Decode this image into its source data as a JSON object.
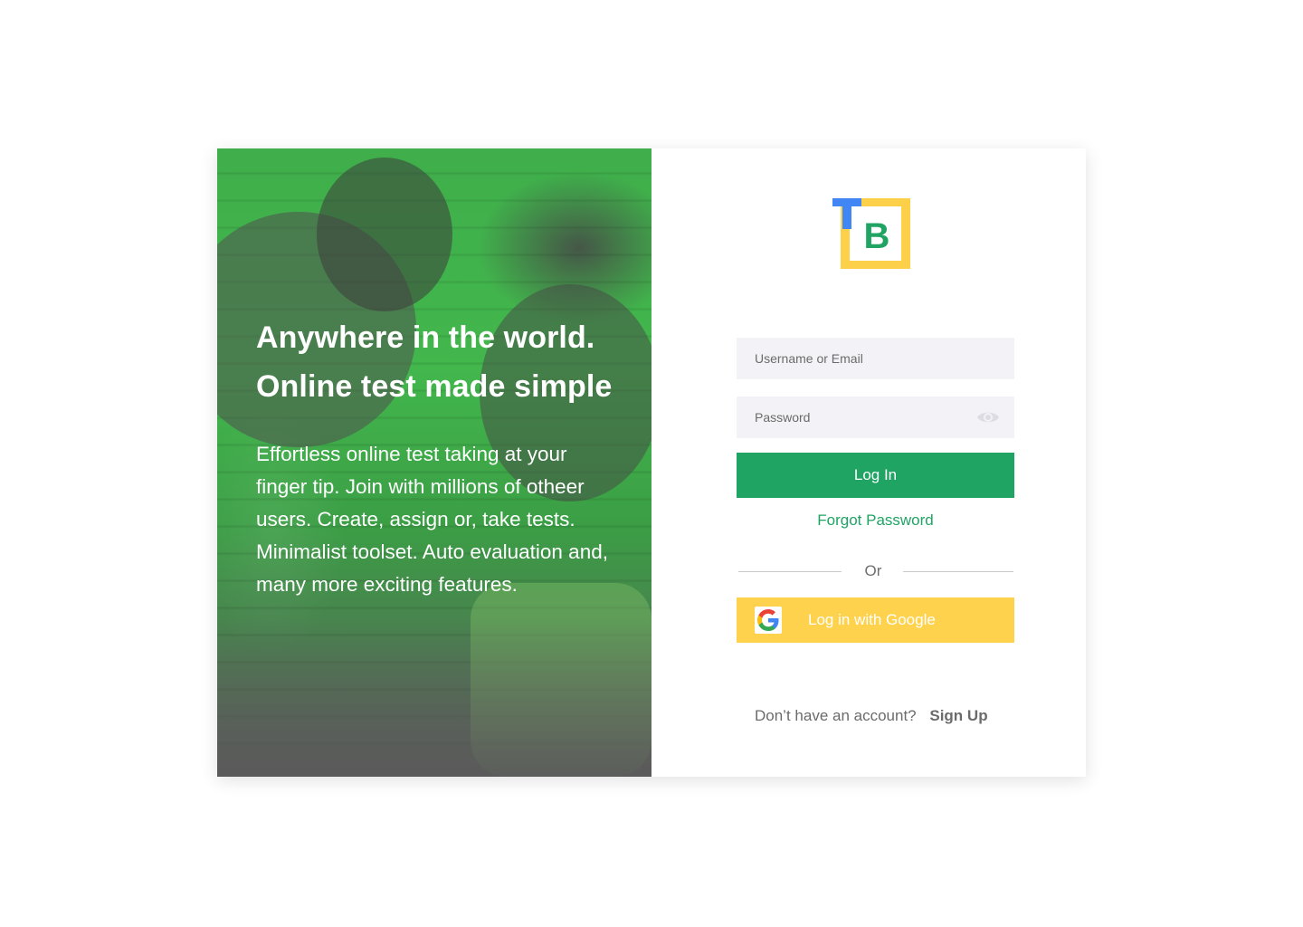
{
  "hero": {
    "title_line1": "Anywhere in the world.",
    "title_line2": "Online test made simple",
    "description": "Effortless online test taking at your finger tip. Join with millions of otheer users. Create, assign or, take tests. Minimalist toolset. Auto evaluation and, many more exciting features."
  },
  "logo": {
    "letter_t": "T",
    "letter_b": "B",
    "colors": {
      "t": "#4285f4",
      "b": "#20a464",
      "frame": "#fdd04a"
    }
  },
  "form": {
    "username_placeholder": "Username or Email",
    "password_placeholder": "Password",
    "password_toggle_icon": "eye-icon",
    "login_label": "Log In",
    "forgot_label": "Forgot Password",
    "or_label": "Or",
    "google_label": "Log in with Google",
    "google_icon": "google-g-icon"
  },
  "signup": {
    "prompt": "Don’t have an account?",
    "link_label": "Sign Up"
  },
  "colors": {
    "primary_green": "#20a464",
    "google_yellow": "#ffd24d",
    "input_bg": "#f2f2f7"
  }
}
